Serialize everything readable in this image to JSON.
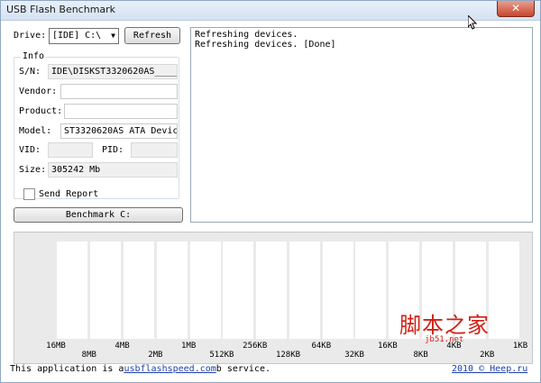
{
  "window": {
    "title": "USB Flash Benchmark",
    "close_label": "✕"
  },
  "controls": {
    "drive_label": "Drive:",
    "drive_selected": "[IDE] C:\\",
    "refresh_label": "Refresh",
    "send_report_label": "Send Report",
    "send_report_checked": false,
    "benchmark_label": "Benchmark C:"
  },
  "info": {
    "legend": "Info",
    "sn_label": "S/N:",
    "sn_value": "IDE\\DISKST3320620AS_____",
    "vendor_label": "Vendor:",
    "vendor_value": "",
    "product_label": "Product:",
    "product_value": "",
    "model_label": "Model:",
    "model_value": "ST3320620AS ATA Device",
    "vid_label": "VID:",
    "vid_value": "",
    "pid_label": "PID:",
    "pid_value": "",
    "size_label": "Size:",
    "size_value": "305242 Mb"
  },
  "log": {
    "lines": [
      "Refreshing devices.",
      "Refreshing devices. [Done]"
    ]
  },
  "chart_data": {
    "type": "bar",
    "categories": [
      "16MB",
      "8MB",
      "4MB",
      "2MB",
      "1MB",
      "512KB",
      "256KB",
      "128KB",
      "64KB",
      "32KB",
      "16KB",
      "8KB",
      "4KB",
      "2KB",
      "1KB"
    ],
    "values": [],
    "tick_rows": {
      "top": [
        "16MB",
        "4MB",
        "1MB",
        "256KB",
        "64KB",
        "16KB",
        "4KB",
        "1KB"
      ],
      "bottom": [
        "8MB",
        "2MB",
        "512KB",
        "128KB",
        "32KB",
        "8KB",
        "2KB"
      ]
    },
    "background": "#eaeaea",
    "column_color": "#ffffff"
  },
  "footer": {
    "text_before": "This application is a",
    "link": "usbflashspeed.com",
    "text_after": "b service.",
    "copyright": "2010 © Heep.ru"
  },
  "watermark": {
    "text": "脚本之家",
    "url": "jb51.net"
  },
  "colors": {
    "link": "#1b3fb0",
    "close_button": "#c9452c",
    "watermark": "#d11f14"
  },
  "icons": {
    "close": "close-icon",
    "dropdown": "chevron-down-icon",
    "cursor": "mouse-cursor-icon"
  }
}
